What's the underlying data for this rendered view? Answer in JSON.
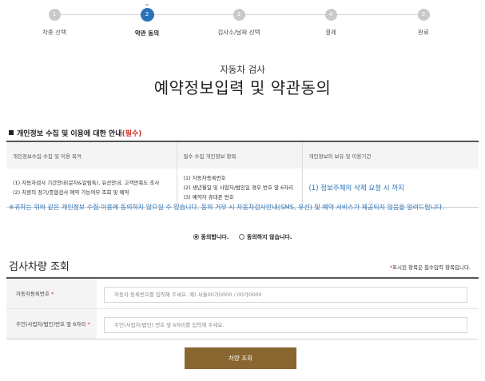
{
  "stepper": {
    "active_marker": "⌄",
    "steps": [
      {
        "number": "1",
        "label": "차종 선택"
      },
      {
        "number": "2",
        "label": "약관 동의"
      },
      {
        "number": "3",
        "label": "검사소/날짜 선택"
      },
      {
        "number": "4",
        "label": "결제"
      },
      {
        "number": "5",
        "label": "완료"
      }
    ],
    "active_step": 2,
    "colors": {
      "active": "#2a72b8",
      "inactive": "#c9c9c9"
    }
  },
  "header": {
    "subtitle": "자동차 검사",
    "title": "예약정보입력 및 약관동의"
  },
  "privacy": {
    "heading": "개인정보 수집 및 이용에 대한 안내",
    "heading_required": "(필수)",
    "columns": [
      "개인정보수집 수집 및 이용 목적",
      "필수 수집 개인정보 항목",
      "개인정보의 보유 및 이용기간"
    ],
    "purpose_lines": [
      "(1) 자동차검사 기간안내(문자&알림톡), 유선안내, 고객만족도 조사",
      "(2) 차량의 정기/종합검사 예약 가능여부 조회 및 예약"
    ],
    "items_lines": [
      "(1) 자동차등록번호",
      "(2) 생년월일 및 사업자/법인일 경우 번호 앞 6자리",
      "(3) 예약자 휴대폰 번호"
    ],
    "retention": "(1) 정보주체의 삭제 요청 시 까지",
    "notice": "※귀하는 위와 같은 개인정보 수집·이용에 동의하지 않으실 수 있습니다. 동의 거부 시 자동차검사안내(SMS, 유선) 및 예약 서비스가 제공되지 않음을 알려드립니다.",
    "consent": {
      "agree": "동의합니다.",
      "disagree": "동의하지 않습니다.",
      "selected": "agree"
    }
  },
  "lookup": {
    "title": "검사차량 조회",
    "required_note_star": "*",
    "required_note": "표시된 항목은 필수입력 항목입니다.",
    "fields": [
      {
        "label": "자동차등록번호",
        "star": "*",
        "placeholder": "자동차 등록번호를 입력해 주세요. 예) 서울00가0000 / 00가0000",
        "value": ""
      },
      {
        "label": "주민(사업자/법인)번호 앞 6자리",
        "star": "*",
        "placeholder": "주민(사업자/법인) 번호 앞 6자리를 입력해 주세요.",
        "value": ""
      }
    ],
    "button": "차량 조회",
    "button_color": "#8a6631"
  }
}
